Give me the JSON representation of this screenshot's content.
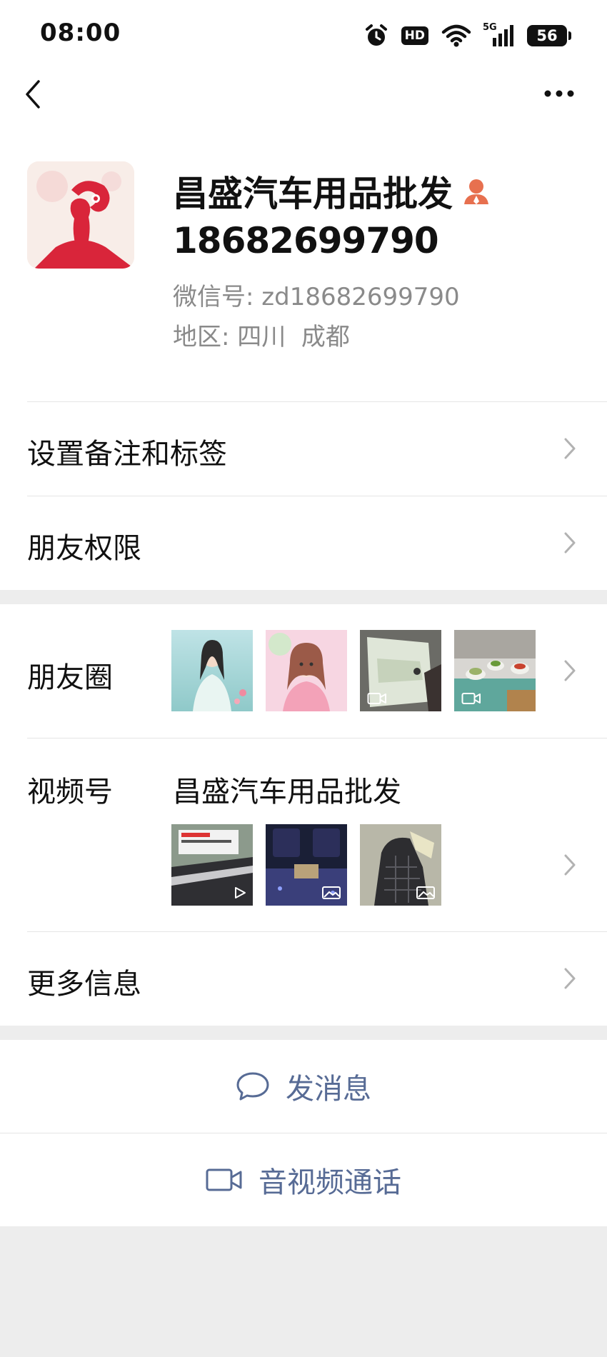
{
  "status_bar": {
    "time": "08:00",
    "hd": "HD",
    "network": "5G",
    "battery": "56"
  },
  "nav": {
    "back_icon": "chevron-left-icon",
    "more_icon": "more-horizontal-icon"
  },
  "profile": {
    "name": "昌盛汽车用品批发",
    "phone": "18682699790",
    "wechat_id_label": "微信号:",
    "wechat_id": "zd18682699790",
    "region_label": "地区:",
    "region": "四川  成都",
    "badge_icon": "contact-person-icon",
    "badge_color": "#e7704f"
  },
  "menu": {
    "remark": "设置备注和标签",
    "permissions": "朋友权限",
    "moments": "朋友圈",
    "channels": "视频号",
    "channels_name": "昌盛汽车用品批发",
    "more_info": "更多信息"
  },
  "moments_thumbs": [
    {
      "desc": "woman praying",
      "video": false
    },
    {
      "desc": "cartoon girl",
      "video": false
    },
    {
      "desc": "car interior",
      "video": true
    },
    {
      "desc": "food on table",
      "video": true
    }
  ],
  "channel_thumbs": [
    {
      "desc": "car product box",
      "type": "play"
    },
    {
      "desc": "car seats",
      "type": "image"
    },
    {
      "desc": "seat cover",
      "type": "image"
    }
  ],
  "actions": {
    "message": "发消息",
    "call": "音视频通话",
    "link_color": "#576b95"
  }
}
